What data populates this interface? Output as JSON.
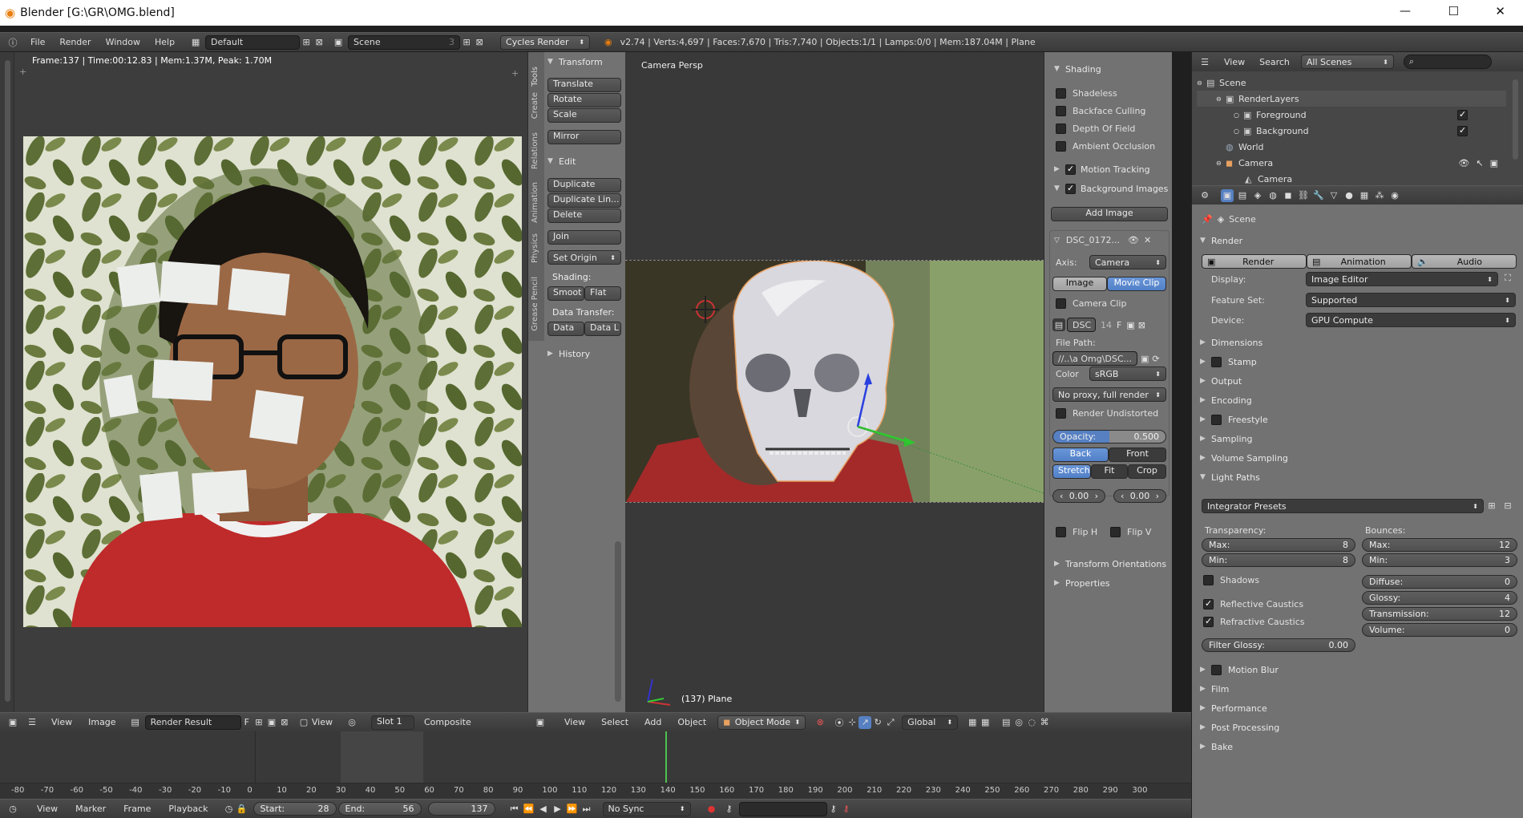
{
  "window": {
    "title": "Blender [G:\\GR\\OMG.blend]",
    "minimize": "—",
    "maximize": "☐",
    "close": "✕"
  },
  "topbar": {
    "menus": [
      "File",
      "Render",
      "Window",
      "Help"
    ],
    "layout": "Default",
    "scene": "Scene",
    "scene_num": "3",
    "engine": "Cycles Render",
    "stats": "v2.74 | Verts:4,697 | Faces:7,670 | Tris:7,740 | Objects:1/1 | Lamps:0/0 | Mem:187.04M | Plane"
  },
  "image_editor": {
    "info": "Frame:137 | Time:00:12.83 | Mem:1.37M, Peak: 1.70M",
    "header_items": [
      "View",
      "Image"
    ],
    "image_name": "Render Result",
    "f_label": "F",
    "view_label": "View",
    "slot": "Slot 1",
    "pass": "Composite"
  },
  "tool_shelf": {
    "tabs": [
      "Tools",
      "Create",
      "Relations",
      "Animation",
      "Physics",
      "Grease Pencil"
    ],
    "transform_title": "Transform",
    "transform_buttons": [
      "Translate",
      "Rotate",
      "Scale"
    ],
    "mirror": "Mirror",
    "edit_title": "Edit",
    "edit_buttons": [
      "Duplicate",
      "Duplicate Lin...",
      "Delete"
    ],
    "join": "Join",
    "set_origin": "Set Origin",
    "shading_label": "Shading:",
    "smooth": "Smoot",
    "flat": "Flat",
    "data_transfer_label": "Data Transfer:",
    "data": "Data",
    "data_l": "Data L",
    "history": "History"
  },
  "viewport": {
    "label": "Camera Persp",
    "object_label": "(137) Plane",
    "header_items": [
      "View",
      "Select",
      "Add",
      "Object"
    ],
    "mode": "Object Mode",
    "orientation": "Global"
  },
  "n_panel": {
    "shading_title": "Shading",
    "shading_opts": [
      {
        "label": "Shadeless",
        "on": false
      },
      {
        "label": "Backface Culling",
        "on": false
      },
      {
        "label": "Depth Of Field",
        "on": false
      },
      {
        "label": "Ambient Occlusion",
        "on": false
      }
    ],
    "motion_tracking": "Motion Tracking",
    "background_images": "Background Images",
    "add_image": "Add Image",
    "bg_name": "DSC_0172...",
    "axis_label": "Axis:",
    "axis_value": "Camera",
    "image_tab": "Image",
    "movie_clip_tab": "Movie Clip",
    "camera_clip": "Camera Clip",
    "clip_name": "DSC",
    "clip_num": "14",
    "clip_f": "F",
    "file_path_label": "File Path:",
    "file_path": "//..\\a Omg\\DSC...",
    "color_label": "Color",
    "color_value": "sRGB",
    "proxy": "No proxy, full render",
    "render_undistorted": "Render Undistorted",
    "opacity_label": "Opacity:",
    "opacity_value": "0.500",
    "back": "Back",
    "front": "Front",
    "stretch": "Stretch",
    "fit": "Fit",
    "crop": "Crop",
    "offset_x": "0.00",
    "offset_y": "0.00",
    "flip_h": "Flip H",
    "flip_v": "Flip V",
    "transform_orientations": "Transform Orientations",
    "properties": "Properties"
  },
  "outliner": {
    "header_items": [
      "View",
      "Search"
    ],
    "filter": "All Scenes",
    "tree": [
      {
        "label": "Scene",
        "indent": 0
      },
      {
        "label": "RenderLayers",
        "indent": 1
      },
      {
        "label": "Foreground",
        "indent": 2
      },
      {
        "label": "Background",
        "indent": 2
      },
      {
        "label": "World",
        "indent": 1
      },
      {
        "label": "Camera",
        "indent": 1
      },
      {
        "label": "Camera",
        "indent": 2
      }
    ]
  },
  "properties": {
    "context": "Scene",
    "render_title": "Render",
    "render_btn": "Render",
    "animation_btn": "Animation",
    "audio_btn": "Audio",
    "display_label": "Display:",
    "display_value": "Image Editor",
    "feature_label": "Feature Set:",
    "feature_value": "Supported",
    "device_label": "Device:",
    "device_value": "GPU Compute",
    "sections_top": [
      {
        "label": "Dimensions",
        "cb": false
      },
      {
        "label": "Stamp",
        "cb": true
      },
      {
        "label": "Output",
        "cb": false
      },
      {
        "label": "Encoding",
        "cb": false
      },
      {
        "label": "Freestyle",
        "cb": true
      },
      {
        "label": "Sampling",
        "cb": false
      },
      {
        "label": "Volume Sampling",
        "cb": false
      }
    ],
    "light_paths": "Light Paths",
    "integrator_presets": "Integrator Presets",
    "transparency_label": "Transparency:",
    "bounces_label": "Bounces:",
    "t_max_label": "Max:",
    "t_max": "8",
    "t_min_label": "Min:",
    "t_min": "8",
    "b_max_label": "Max:",
    "b_max": "12",
    "b_min_label": "Min:",
    "b_min": "3",
    "shadows": "Shadows",
    "diffuse_label": "Diffuse:",
    "diffuse": "0",
    "glossy_label": "Glossy:",
    "glossy": "4",
    "transmission_label": "Transmission:",
    "transmission": "12",
    "volume_label": "Volume:",
    "volume": "0",
    "reflective": "Reflective Caustics",
    "refractive": "Refractive Caustics",
    "filter_glossy_label": "Filter Glossy:",
    "filter_glossy": "0.00",
    "sections_bottom": [
      {
        "label": "Motion Blur",
        "cb": true
      },
      {
        "label": "Film",
        "cb": false
      },
      {
        "label": "Performance",
        "cb": false
      },
      {
        "label": "Post Processing",
        "cb": false
      },
      {
        "label": "Bake",
        "cb": false
      }
    ]
  },
  "timeline": {
    "ruler": [
      "-80",
      "-70",
      "-60",
      "-50",
      "-40",
      "-30",
      "-20",
      "-10",
      "0",
      "10",
      "20",
      "30",
      "40",
      "50",
      "60",
      "70",
      "80",
      "90",
      "100",
      "110",
      "120",
      "130",
      "140",
      "150",
      "160",
      "170",
      "180",
      "190",
      "200",
      "210",
      "220",
      "230",
      "240",
      "250",
      "260",
      "270",
      "280",
      "290",
      "300"
    ],
    "menus": [
      "View",
      "Marker",
      "Frame",
      "Playback"
    ],
    "start_label": "Start:",
    "start": "28",
    "end_label": "End:",
    "end": "56",
    "current": "137",
    "sync": "No Sync"
  },
  "colors": {
    "accent": "#5680c2",
    "viewport_bg": "#393939",
    "panel": "#727272"
  }
}
